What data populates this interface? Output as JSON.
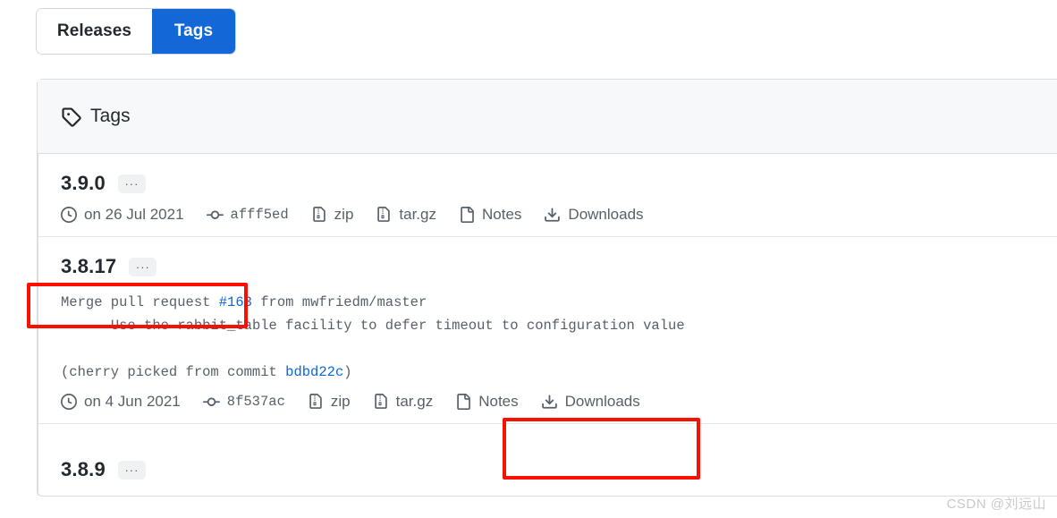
{
  "tabs": [
    {
      "label": "Releases",
      "name": "tab-releases",
      "active": false
    },
    {
      "label": "Tags",
      "name": "tab-tags",
      "active": true
    }
  ],
  "card": {
    "header": {
      "icon": "tag-icon",
      "title": "Tags"
    },
    "tags": [
      {
        "name": "3.9.0",
        "ellipsis": "···",
        "commit_message": null,
        "meta": {
          "date": "on 26 Jul 2021",
          "sha": "afff5ed",
          "zip": "zip",
          "targz": "tar.gz",
          "notes": "Notes",
          "downloads": "Downloads"
        }
      },
      {
        "name": "3.8.17",
        "ellipsis": "···",
        "commit_message": {
          "line1_pre": "Merge pull request ",
          "line1_link": "#163",
          "line1_post": " from mwfriedm/master",
          "line2": "      Use the rabbit_table facility to defer timeout to configuration value",
          "line3_blank": "",
          "line4_pre": "(cherry picked from commit ",
          "line4_link": "bdbd22c",
          "line4_post": ")"
        },
        "meta": {
          "date": "on 4 Jun 2021",
          "sha": "8f537ac",
          "zip": "zip",
          "targz": "tar.gz",
          "notes": "Notes",
          "downloads": "Downloads"
        }
      },
      {
        "name": "3.8.9",
        "ellipsis": "···",
        "commit_message": null,
        "meta": null
      }
    ]
  },
  "annotations": {
    "box_color": "#fa0f00",
    "box_tag_name_target": "3.8.17",
    "box_downloads_target": "Downloads"
  },
  "watermark": "CSDN @刘远山",
  "colors": {
    "accent_blue": "#1367d7",
    "link_blue": "#0969da",
    "border": "#d8dee4",
    "header_bg": "#f6f8fa",
    "muted_text": "#57606a",
    "annotation_red": "#fa0f00"
  }
}
